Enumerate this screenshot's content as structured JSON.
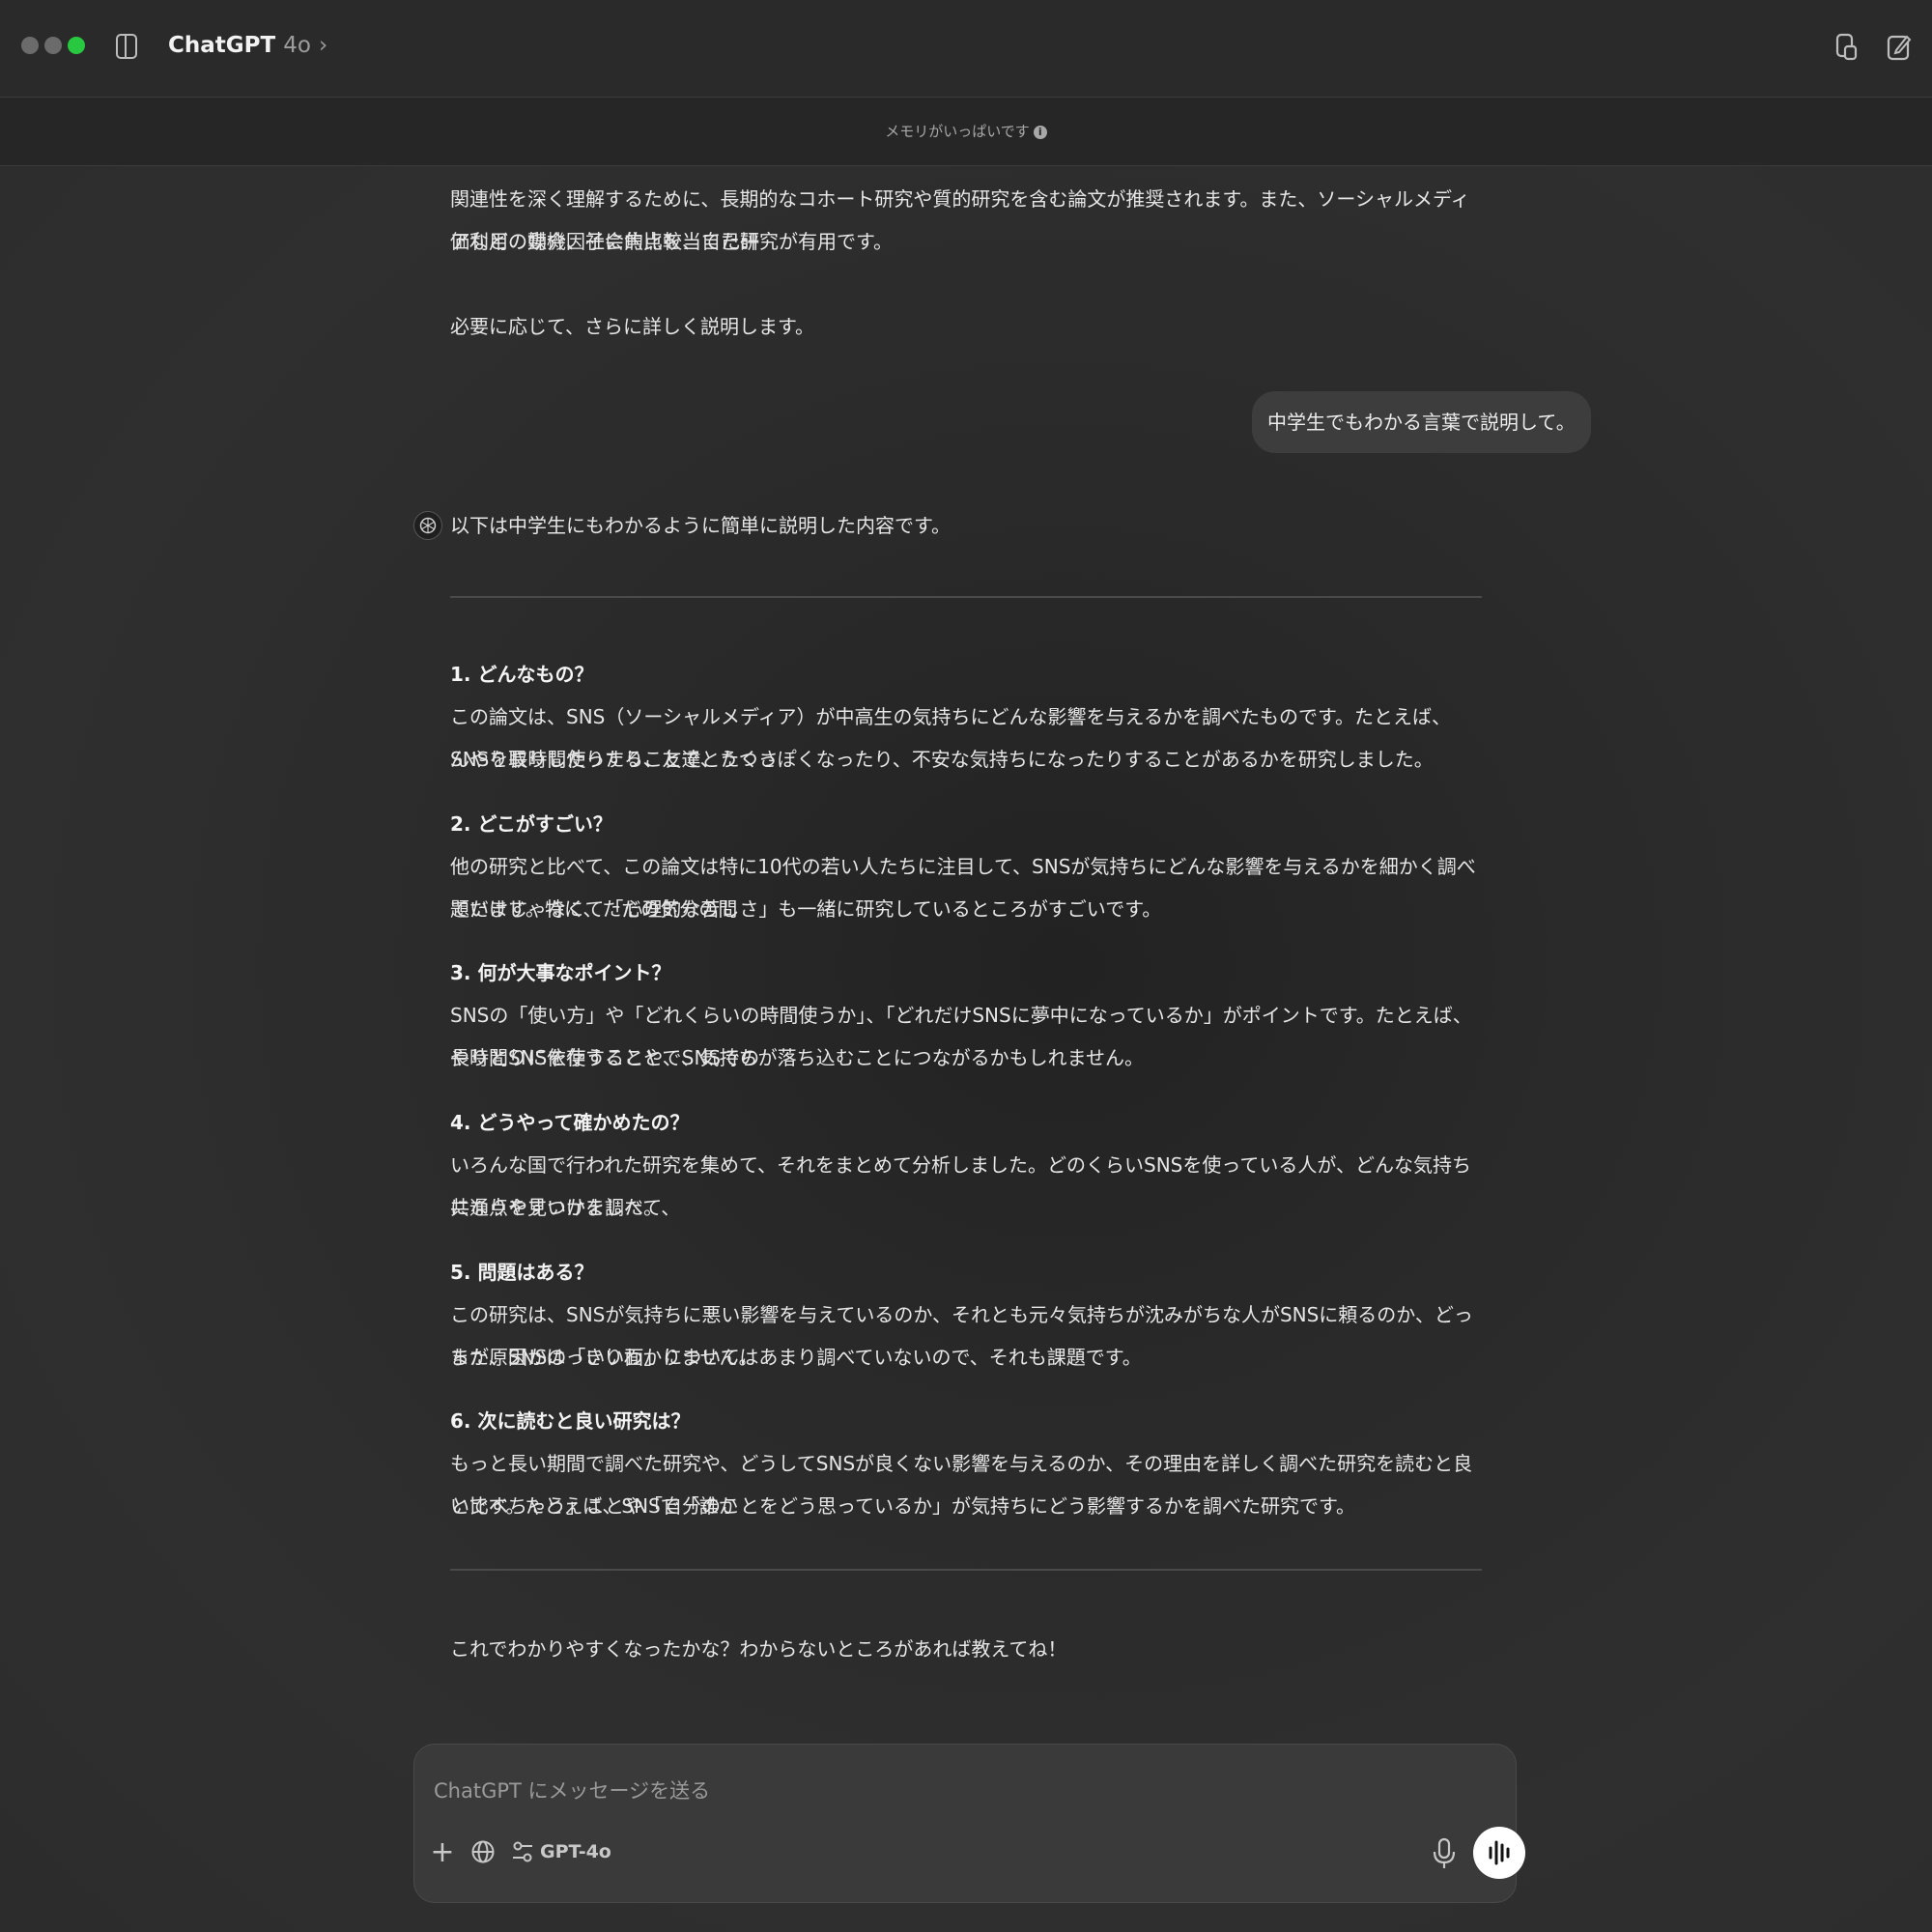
{
  "titlebar": {
    "model_name": "ChatGPT",
    "model_version": "4o",
    "chevron": "›"
  },
  "banner": {
    "text": "メモリがいっぱいです",
    "info_glyph": "i"
  },
  "messages": {
    "prev_assistant_p1_line1": "関連性を深く理解するために、長期的なコホート研究や質的研究を含む論文が推奨されます。また、ソーシャルメディア利用の動機、社会的比較、自己評",
    "prev_assistant_p1_line2": "価などの媒介因子に焦点を当てた研究が有用です。",
    "prev_assistant_p2": "必要に応じて、さらに詳しく説明します。",
    "user_message": "中学生でもわかる言葉で説明して。",
    "assistant_intro": "以下は中学生にもわかるように簡単に説明した内容です。",
    "sections": [
      {
        "heading": "1. どんなもの？",
        "line1": "この論文は、SNS（ソーシャルメディア）が中高生の気持ちにどんな影響を与えるかを調べたものです。たとえば、SNSを長時間使ったり、友達とたくさ",
        "line2": "んやり取りしたりすることで、うつっぽくなったり、不安な気持ちになったりすることがあるかを研究しました。"
      },
      {
        "heading": "2. どこがすごい？",
        "line1": "他の研究と比べて、この論文は特に10代の若い人たちに注目して、SNSが気持ちにどんな影響を与えるかを細かく調べています。特に、ただの気分の問",
        "line2": "題だけじゃなくて「心理的な苦しさ」も一緒に研究しているところがすごいです。"
      },
      {
        "heading": "3. 何が大事なポイント？",
        "line1": "SNSの「使い方」や「どれくらいの時間使うか」、「どれだけSNSに夢中になっているか」がポイントです。たとえば、長時間SNSを使うことや、SNSでの",
        "line2": "やりとりに依存することで、気持ちが落ち込むことにつながるかもしれません。"
      },
      {
        "heading": "4. どうやって確かめたの？",
        "line1": "いろんな国で行われた研究を集めて、それをまとめて分析しました。どのくらいSNSを使っている人が、どんな気持ちになりやすいかを調べて、",
        "line2": "共通点を見つけました。"
      },
      {
        "heading": "5. 問題はある？",
        "line1": "この研究は、SNSが気持ちに悪い影響を与えているのか、それとも元々気持ちが沈みがちな人がSNSに頼るのか、どっちが原因かはっきりわかりません。",
        "line2": "また、SNSの「いい面」についてはあまり調べていないので、それも課題です。"
      },
      {
        "heading": "6. 次に読むと良い研究は？",
        "line1": "もっと長い期間で調べた研究や、どうしてSNSが良くない影響を与えるのか、その理由を詳しく調べた研究を読むと良いです。たとえば、SNSで「誰か",
        "line2": "と比べちゃう」ことや「自分のことをどう思っているか」が気持ちにどう影響するかを調べた研究です。"
      }
    ],
    "closing": "これでわかりやすくなったかな？わからないところがあれば教えてね！"
  },
  "composer": {
    "placeholder": "ChatGPT にメッセージを送る",
    "value": "",
    "model_chip": "GPT-4o",
    "plus_glyph": "+"
  },
  "icons": {
    "traffic_lights": [
      "close-dot",
      "minimize-dot",
      "zoom-dot"
    ],
    "titlebar_right": [
      "copy-window-icon",
      "new-chat-icon"
    ],
    "composer": [
      "plus-icon",
      "globe-icon",
      "tools-icon",
      "mic-icon",
      "voice-wave-icon"
    ]
  },
  "colors": {
    "background": "#2b2b2b",
    "text": "#e6e6e6",
    "user_bubble": "#3d3d3d",
    "zoom_dot": "#28c840",
    "voice_button": "#ffffff"
  }
}
